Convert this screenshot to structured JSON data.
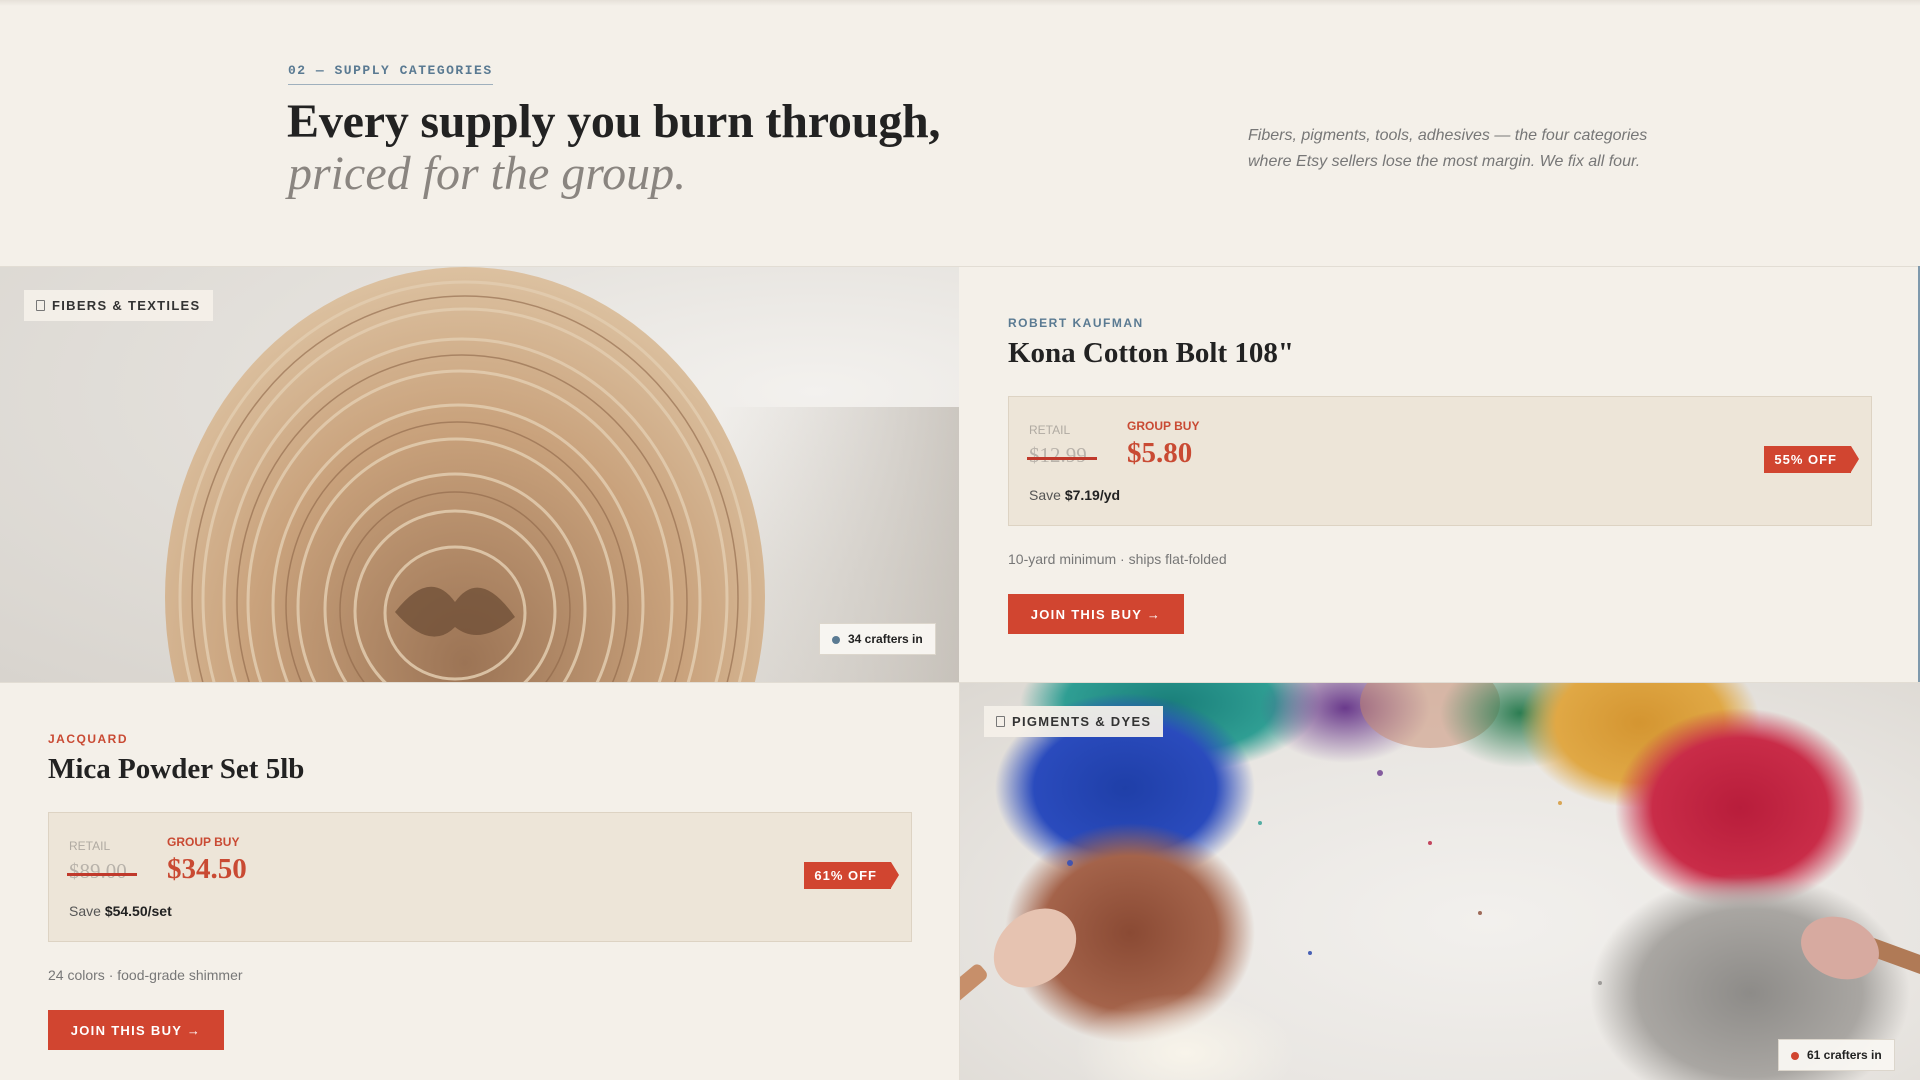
{
  "section": {
    "eyebrow": "02 — SUPPLY CATEGORIES",
    "headline": "Every supply you burn through,",
    "headline_italic": "priced for the group.",
    "intro": "Fibers, pigments, tools, adhesives — the four categories where Etsy sellers lose the most margin. We fix all four."
  },
  "cards": {
    "kona": {
      "category": "FIBERS & TEXTILES",
      "category_icon": "tag-icon",
      "crafters": "34 crafters in",
      "crafters_dot_color": "#5a7a92",
      "brand": "ROBERT KAUFMAN",
      "brand_color": "#5a7a92",
      "title": "Kona Cotton Bolt 108\"",
      "retail_label": "RETAIL",
      "retail_price": "$12.99",
      "group_label": "GROUP BUY",
      "group_price": "$5.80",
      "save_prefix": "Save",
      "save_amount": "$7.19/yd",
      "discount": "55% OFF",
      "details": "10-yard minimum · ships flat-folded",
      "cta": "JOIN THIS BUY →"
    },
    "mica": {
      "category": "PIGMENTS & DYES",
      "category_icon": "tag-icon",
      "crafters": "61 crafters in",
      "crafters_dot_color": "#d14530",
      "brand": "JACQUARD",
      "brand_color": "#c94a33",
      "title": "Mica Powder Set 5lb",
      "retail_label": "RETAIL",
      "retail_price": "$89.00",
      "group_label": "GROUP BUY",
      "group_price": "$34.50",
      "save_prefix": "Save",
      "save_amount": "$54.50/set",
      "discount": "61% OFF",
      "details": "24 colors · food-grade shimmer",
      "cta": "JOIN THIS BUY →"
    }
  },
  "colors": {
    "background": "#f4f0e9",
    "accent": "#d14530",
    "price_box": "#ede5d8",
    "eyebrow": "#5a7a92"
  }
}
